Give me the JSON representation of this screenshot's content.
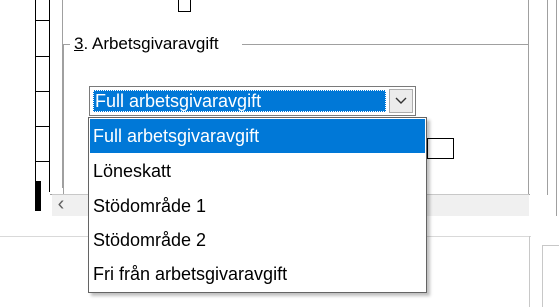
{
  "section": {
    "number": "3",
    "label": ". Arbetsgivaravgift"
  },
  "combo": {
    "value": "Full arbetsgivaravgift",
    "button_icon": "chevron-down-icon"
  },
  "dropdown": {
    "options": [
      "Full arbetsgivaravgift",
      "Löneskatt",
      "Stödområde 1",
      "Stödområde 2",
      "Fri från arbetsgivaravgift"
    ],
    "selected_index": 0
  },
  "scroll": {
    "left_arrow": "‹"
  },
  "colors": {
    "accent": "#0078d7"
  }
}
